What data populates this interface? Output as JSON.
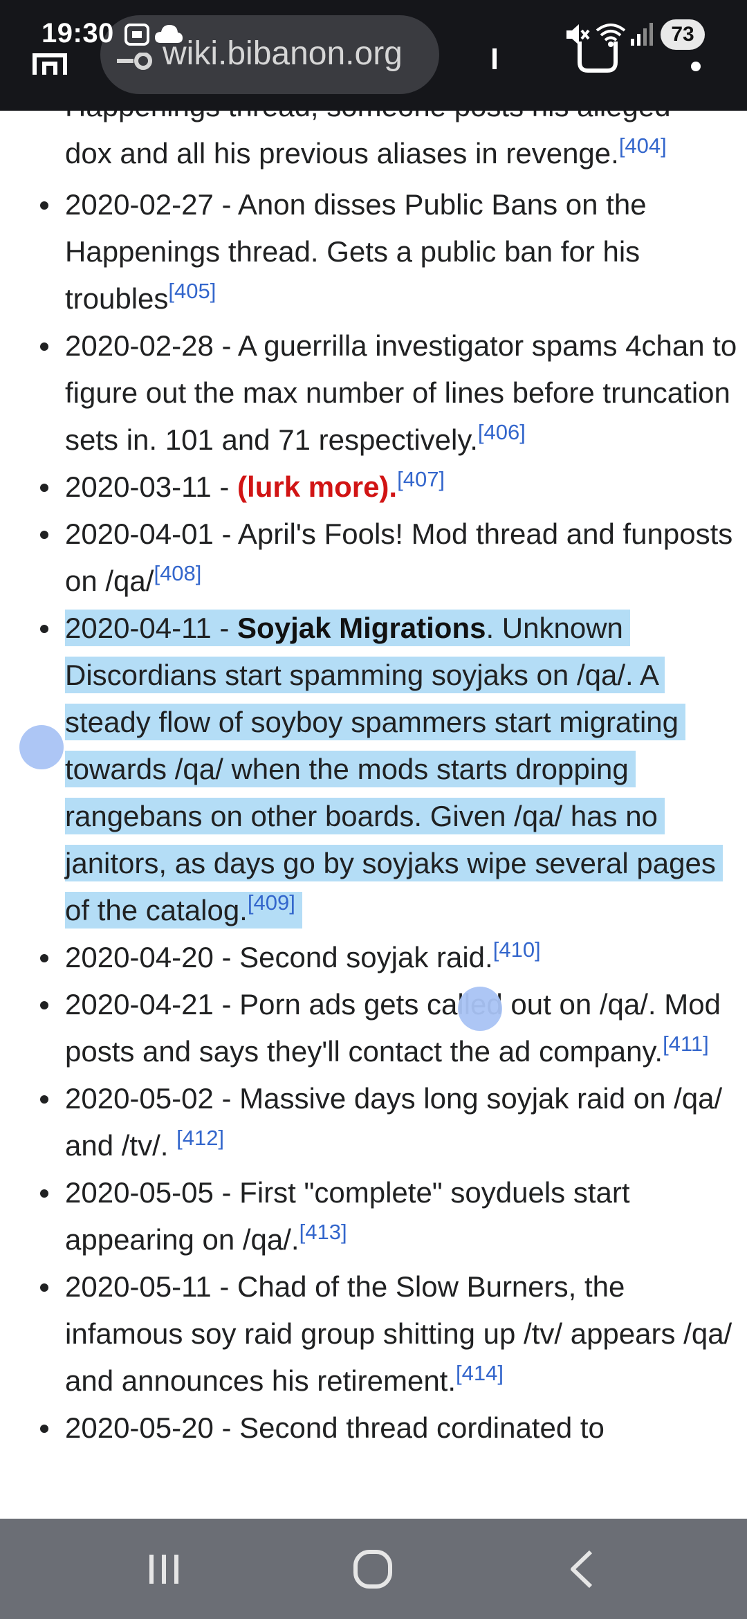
{
  "status_bar": {
    "time": "19:30",
    "battery": "73",
    "icons": [
      "screenshot-icon",
      "cloud-icon",
      "mute-icon",
      "wifi-icon",
      "signal-icon"
    ]
  },
  "browser": {
    "url": "wiki.bibanon.org",
    "icons": [
      "home-icon",
      "site-info-icon",
      "share-icon",
      "tab-switcher-icon",
      "more-menu-icon"
    ]
  },
  "article": {
    "top_partial_line": "Happenings thread, someone posts his alleged",
    "first_entry": {
      "text": "dox and all his previous aliases in revenge.",
      "ref": "[404]"
    },
    "entries": [
      {
        "date": "2020-02-27 - ",
        "text": "Anon disses Public Bans on the Happenings thread. Gets a public ban for his troubles",
        "ref": "[405]"
      },
      {
        "date": "2020-02-28 - ",
        "text": "A guerrilla investigator spams 4chan to figure out the max number of lines before truncation sets in. 101 and 71 respectively.",
        "ref": "[406]"
      },
      {
        "date": "2020-03-11 - ",
        "link": "(lurk more).",
        "ref": "[407]"
      },
      {
        "date": "2020-04-01 - ",
        "text": "April's Fools! Mod thread and funposts on /qa/",
        "ref": "[408]"
      },
      {
        "date": "2020-04-11 - ",
        "bold": "Soyjak Migrations",
        "text": ". Unknown Discordians start spamming soyjaks on /qa/. A steady flow of soyboy spammers start migrating towards /qa/ when the mods starts dropping rangebans on other boards. Given /qa/ has no janitors, as days go by soyjaks wipe several pages of the catalog.",
        "ref": "[409]",
        "selected": true
      },
      {
        "date": "2020-04-20 - ",
        "text": "Second soyjak raid.",
        "ref": "[410]"
      },
      {
        "date": "2020-04-21 - ",
        "text": "Porn ads gets called out on /qa/. Mod posts and says they'll contact the ad company.",
        "ref": "[411]"
      },
      {
        "date": "2020-05-02 - ",
        "text": "Massive days long soyjak raid on /qa/ and /tv/. ",
        "ref": "[412]"
      },
      {
        "date": "2020-05-05 - ",
        "text": "First \"complete\" soyduels start appearing on /qa/.",
        "ref": "[413]"
      },
      {
        "date": "2020-05-11 - ",
        "text": "Chad of the Slow Burners, the infamous soy raid group shitting up /tv/ appears /qa/ and announces his retirement.",
        "ref": "[414]"
      },
      {
        "date": "2020-05-20 - ",
        "text": "Second thread cordinated to"
      }
    ]
  },
  "nav_bar": {
    "buttons": [
      "recent-apps-button",
      "home-button",
      "back-button"
    ]
  },
  "colors": {
    "selection": "#b4ddf6",
    "selection_handle": "#a9c3f4",
    "link": "#3366cc",
    "red_link": "#d11414",
    "status_bar_bg": "#15161a",
    "nav_bar_bg": "#6b6e75"
  }
}
